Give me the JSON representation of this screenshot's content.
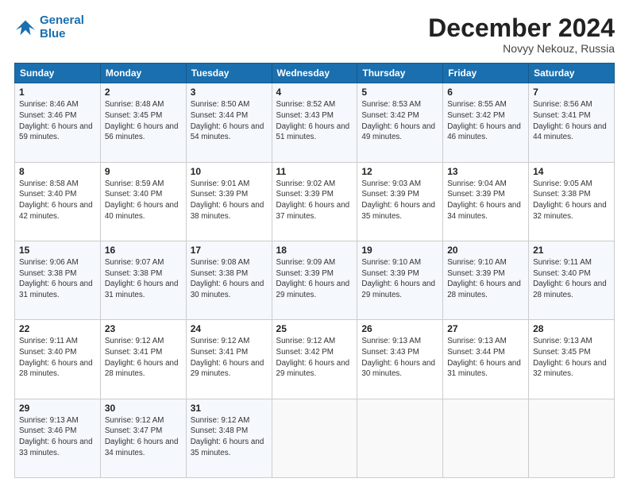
{
  "header": {
    "logo_line1": "General",
    "logo_line2": "Blue",
    "title": "December 2024",
    "subtitle": "Novyy Nekouz, Russia"
  },
  "weekdays": [
    "Sunday",
    "Monday",
    "Tuesday",
    "Wednesday",
    "Thursday",
    "Friday",
    "Saturday"
  ],
  "weeks": [
    [
      {
        "day": "1",
        "sunrise": "Sunrise: 8:46 AM",
        "sunset": "Sunset: 3:46 PM",
        "daylight": "Daylight: 6 hours and 59 minutes."
      },
      {
        "day": "2",
        "sunrise": "Sunrise: 8:48 AM",
        "sunset": "Sunset: 3:45 PM",
        "daylight": "Daylight: 6 hours and 56 minutes."
      },
      {
        "day": "3",
        "sunrise": "Sunrise: 8:50 AM",
        "sunset": "Sunset: 3:44 PM",
        "daylight": "Daylight: 6 hours and 54 minutes."
      },
      {
        "day": "4",
        "sunrise": "Sunrise: 8:52 AM",
        "sunset": "Sunset: 3:43 PM",
        "daylight": "Daylight: 6 hours and 51 minutes."
      },
      {
        "day": "5",
        "sunrise": "Sunrise: 8:53 AM",
        "sunset": "Sunset: 3:42 PM",
        "daylight": "Daylight: 6 hours and 49 minutes."
      },
      {
        "day": "6",
        "sunrise": "Sunrise: 8:55 AM",
        "sunset": "Sunset: 3:42 PM",
        "daylight": "Daylight: 6 hours and 46 minutes."
      },
      {
        "day": "7",
        "sunrise": "Sunrise: 8:56 AM",
        "sunset": "Sunset: 3:41 PM",
        "daylight": "Daylight: 6 hours and 44 minutes."
      }
    ],
    [
      {
        "day": "8",
        "sunrise": "Sunrise: 8:58 AM",
        "sunset": "Sunset: 3:40 PM",
        "daylight": "Daylight: 6 hours and 42 minutes."
      },
      {
        "day": "9",
        "sunrise": "Sunrise: 8:59 AM",
        "sunset": "Sunset: 3:40 PM",
        "daylight": "Daylight: 6 hours and 40 minutes."
      },
      {
        "day": "10",
        "sunrise": "Sunrise: 9:01 AM",
        "sunset": "Sunset: 3:39 PM",
        "daylight": "Daylight: 6 hours and 38 minutes."
      },
      {
        "day": "11",
        "sunrise": "Sunrise: 9:02 AM",
        "sunset": "Sunset: 3:39 PM",
        "daylight": "Daylight: 6 hours and 37 minutes."
      },
      {
        "day": "12",
        "sunrise": "Sunrise: 9:03 AM",
        "sunset": "Sunset: 3:39 PM",
        "daylight": "Daylight: 6 hours and 35 minutes."
      },
      {
        "day": "13",
        "sunrise": "Sunrise: 9:04 AM",
        "sunset": "Sunset: 3:39 PM",
        "daylight": "Daylight: 6 hours and 34 minutes."
      },
      {
        "day": "14",
        "sunrise": "Sunrise: 9:05 AM",
        "sunset": "Sunset: 3:38 PM",
        "daylight": "Daylight: 6 hours and 32 minutes."
      }
    ],
    [
      {
        "day": "15",
        "sunrise": "Sunrise: 9:06 AM",
        "sunset": "Sunset: 3:38 PM",
        "daylight": "Daylight: 6 hours and 31 minutes."
      },
      {
        "day": "16",
        "sunrise": "Sunrise: 9:07 AM",
        "sunset": "Sunset: 3:38 PM",
        "daylight": "Daylight: 6 hours and 31 minutes."
      },
      {
        "day": "17",
        "sunrise": "Sunrise: 9:08 AM",
        "sunset": "Sunset: 3:38 PM",
        "daylight": "Daylight: 6 hours and 30 minutes."
      },
      {
        "day": "18",
        "sunrise": "Sunrise: 9:09 AM",
        "sunset": "Sunset: 3:39 PM",
        "daylight": "Daylight: 6 hours and 29 minutes."
      },
      {
        "day": "19",
        "sunrise": "Sunrise: 9:10 AM",
        "sunset": "Sunset: 3:39 PM",
        "daylight": "Daylight: 6 hours and 29 minutes."
      },
      {
        "day": "20",
        "sunrise": "Sunrise: 9:10 AM",
        "sunset": "Sunset: 3:39 PM",
        "daylight": "Daylight: 6 hours and 28 minutes."
      },
      {
        "day": "21",
        "sunrise": "Sunrise: 9:11 AM",
        "sunset": "Sunset: 3:40 PM",
        "daylight": "Daylight: 6 hours and 28 minutes."
      }
    ],
    [
      {
        "day": "22",
        "sunrise": "Sunrise: 9:11 AM",
        "sunset": "Sunset: 3:40 PM",
        "daylight": "Daylight: 6 hours and 28 minutes."
      },
      {
        "day": "23",
        "sunrise": "Sunrise: 9:12 AM",
        "sunset": "Sunset: 3:41 PM",
        "daylight": "Daylight: 6 hours and 28 minutes."
      },
      {
        "day": "24",
        "sunrise": "Sunrise: 9:12 AM",
        "sunset": "Sunset: 3:41 PM",
        "daylight": "Daylight: 6 hours and 29 minutes."
      },
      {
        "day": "25",
        "sunrise": "Sunrise: 9:12 AM",
        "sunset": "Sunset: 3:42 PM",
        "daylight": "Daylight: 6 hours and 29 minutes."
      },
      {
        "day": "26",
        "sunrise": "Sunrise: 9:13 AM",
        "sunset": "Sunset: 3:43 PM",
        "daylight": "Daylight: 6 hours and 30 minutes."
      },
      {
        "day": "27",
        "sunrise": "Sunrise: 9:13 AM",
        "sunset": "Sunset: 3:44 PM",
        "daylight": "Daylight: 6 hours and 31 minutes."
      },
      {
        "day": "28",
        "sunrise": "Sunrise: 9:13 AM",
        "sunset": "Sunset: 3:45 PM",
        "daylight": "Daylight: 6 hours and 32 minutes."
      }
    ],
    [
      {
        "day": "29",
        "sunrise": "Sunrise: 9:13 AM",
        "sunset": "Sunset: 3:46 PM",
        "daylight": "Daylight: 6 hours and 33 minutes."
      },
      {
        "day": "30",
        "sunrise": "Sunrise: 9:12 AM",
        "sunset": "Sunset: 3:47 PM",
        "daylight": "Daylight: 6 hours and 34 minutes."
      },
      {
        "day": "31",
        "sunrise": "Sunrise: 9:12 AM",
        "sunset": "Sunset: 3:48 PM",
        "daylight": "Daylight: 6 hours and 35 minutes."
      },
      null,
      null,
      null,
      null
    ]
  ]
}
